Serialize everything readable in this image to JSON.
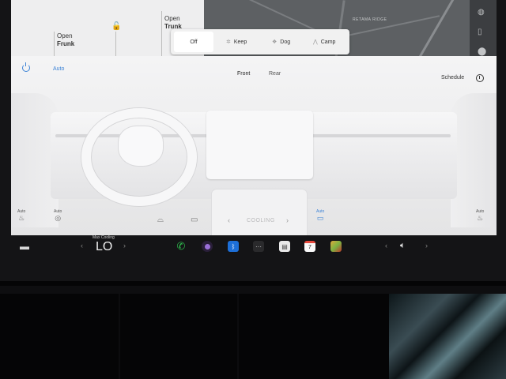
{
  "car_panel": {
    "frunk_action": "Open",
    "frunk_label": "Frunk",
    "trunk_action": "Open",
    "trunk_label": "Trunk"
  },
  "map": {
    "street_label": "RETAMA RIDGE"
  },
  "keep_climate_popup": {
    "options": [
      "Off",
      "Keep",
      "Dog",
      "Camp"
    ],
    "selected": "Off"
  },
  "climate": {
    "auto_label": "Auto",
    "front_tab": "Front",
    "rear_tab": "Rear",
    "schedule_label": "Schedule",
    "fan_status": "COOLING",
    "seat_auto_label": "Auto"
  },
  "taskbar": {
    "temp_mode_label": "Max Cooling",
    "temperature": "LO",
    "calendar_day": "7"
  },
  "colors": {
    "accent_blue": "#3b82d6",
    "phone_green": "#2fbf4f",
    "calendar_red": "#e5483c"
  }
}
